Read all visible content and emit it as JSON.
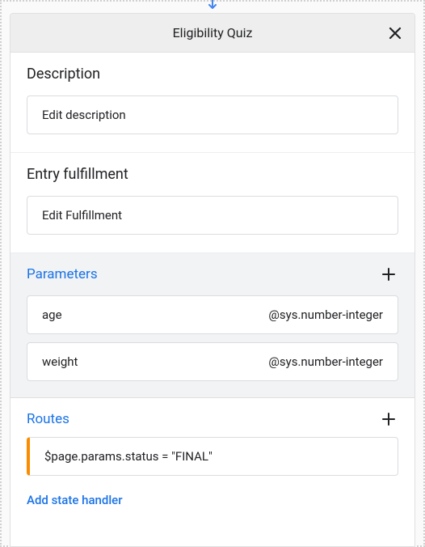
{
  "header": {
    "title": "Eligibility Quiz"
  },
  "description": {
    "title": "Description",
    "placeholder": "Edit description"
  },
  "entryFulfillment": {
    "title": "Entry fulfillment",
    "placeholder": "Edit Fulfillment"
  },
  "parameters": {
    "title": "Parameters",
    "items": [
      {
        "name": "age",
        "type": "@sys.number-integer"
      },
      {
        "name": "weight",
        "type": "@sys.number-integer"
      }
    ]
  },
  "routes": {
    "title": "Routes",
    "items": [
      {
        "condition": "$page.params.status = \"FINAL\""
      }
    ]
  },
  "addStateHandler": {
    "label": "Add state handler"
  }
}
